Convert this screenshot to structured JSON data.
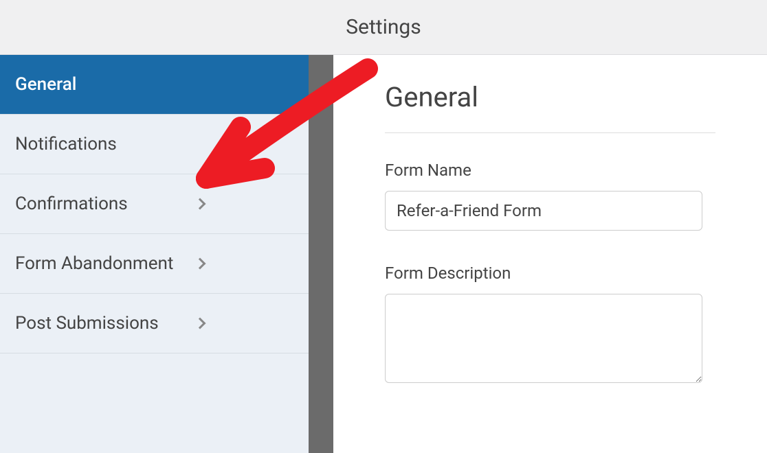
{
  "header": {
    "title": "Settings"
  },
  "sidebar": {
    "items": [
      {
        "label": "General",
        "active": true,
        "hasSubmenu": false
      },
      {
        "label": "Notifications",
        "active": false,
        "hasSubmenu": false
      },
      {
        "label": "Confirmations",
        "active": false,
        "hasSubmenu": true
      },
      {
        "label": "Form Abandonment",
        "active": false,
        "hasSubmenu": true
      },
      {
        "label": "Post Submissions",
        "active": false,
        "hasSubmenu": true
      }
    ]
  },
  "main": {
    "title": "General",
    "formName": {
      "label": "Form Name",
      "value": "Refer-a-Friend Form"
    },
    "formDescription": {
      "label": "Form Description",
      "value": ""
    }
  },
  "annotation": {
    "color": "#ed1c24",
    "target": "Notifications"
  }
}
